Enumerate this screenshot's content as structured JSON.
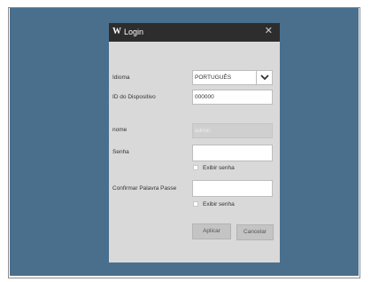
{
  "dialog": {
    "title": "Login",
    "logo": "W",
    "close_icon": "close-icon"
  },
  "form": {
    "language_label": "Idioma",
    "language_value": "PORTUGUÊS",
    "device_id_label": "ID do Dispositivo",
    "device_id_value": "000000",
    "name_label": "nome",
    "name_placeholder": "admin",
    "password_label": "Senha",
    "password_value": "",
    "show_password_label": "Exibir senha",
    "confirm_label": "Confirmar Palavra Passe",
    "confirm_value": "",
    "show_confirm_label": "Exibir senha"
  },
  "buttons": {
    "apply": "Aplicar",
    "cancel": "Cancelar"
  },
  "colors": {
    "desktop": "#4a6f8d",
    "titlebar": "#2d2d2d",
    "dialog": "#d9d9d9"
  }
}
